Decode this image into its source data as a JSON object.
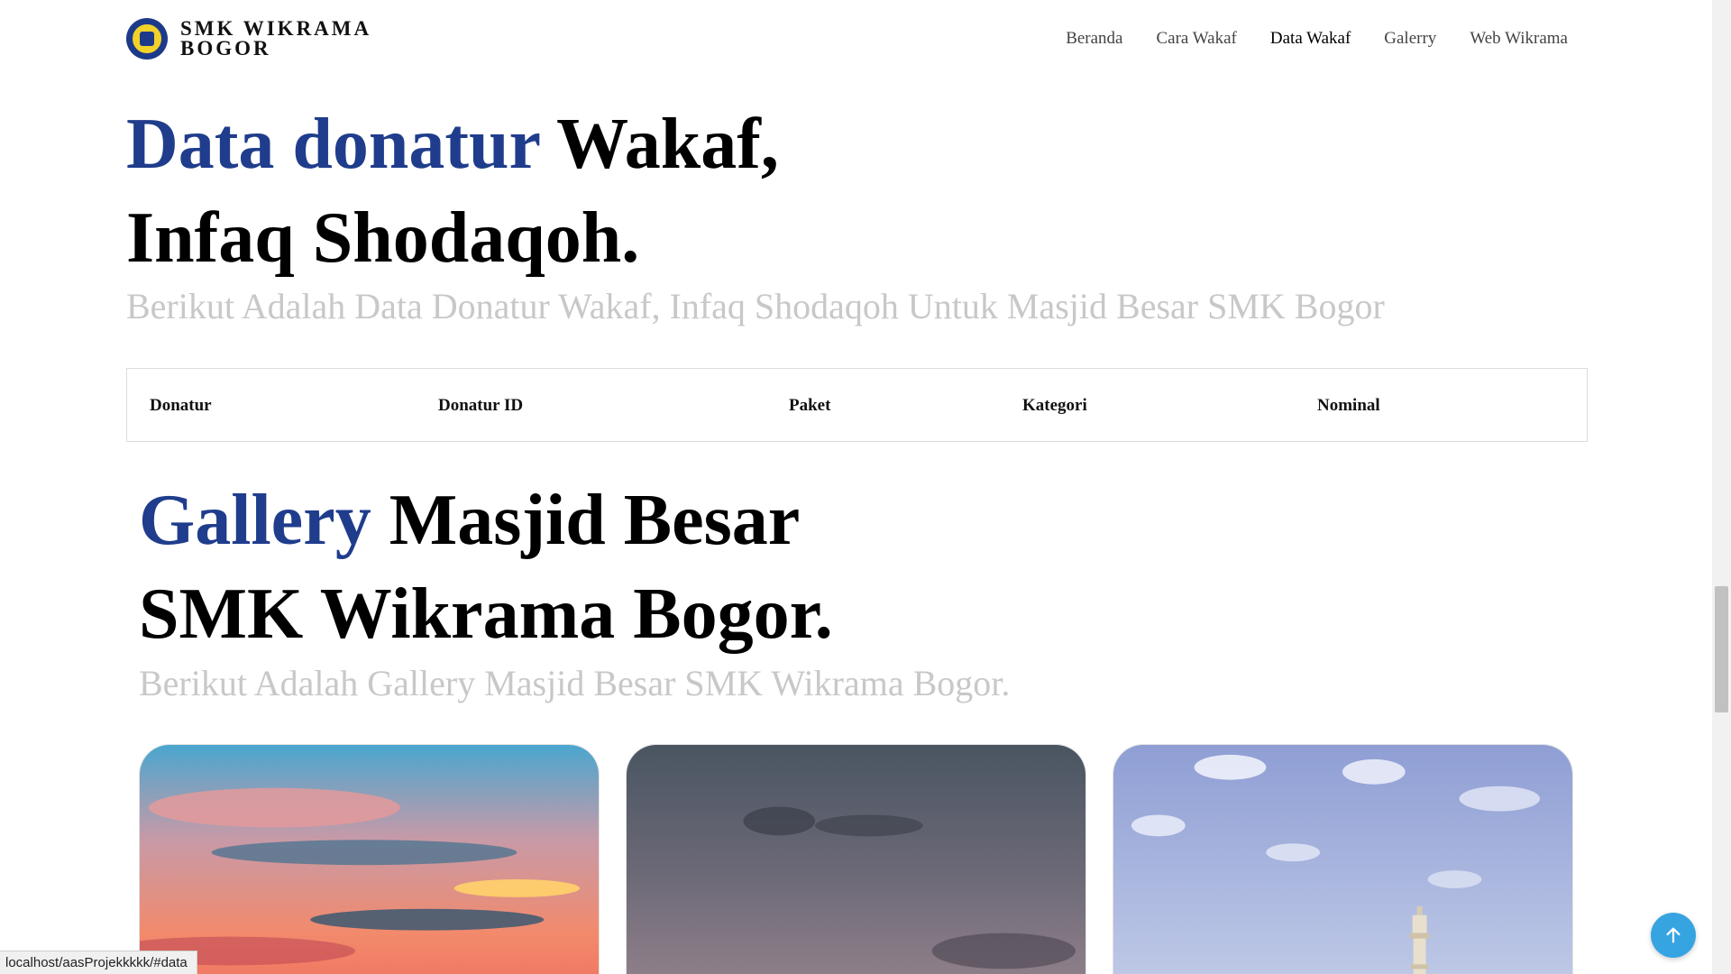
{
  "brand": {
    "line1": "SMK WIKRAMA",
    "line2": "BOGOR"
  },
  "nav": {
    "items": [
      {
        "label": "Beranda"
      },
      {
        "label": "Cara Wakaf"
      },
      {
        "label": "Data Wakaf"
      },
      {
        "label": "Galerry"
      },
      {
        "label": "Web Wikrama"
      }
    ],
    "active": "Data Wakaf"
  },
  "data_section": {
    "title_accent": "Data donatur",
    "title_rest_1": " Wakaf,",
    "title_line2": "Infaq Shodaqoh.",
    "subtitle": "Berikut Adalah Data Donatur Wakaf, Infaq Shodaqoh Untuk Masjid Besar SMK Bogor",
    "table": {
      "columns": [
        "Donatur",
        "Donatur ID",
        "Paket",
        "Kategori",
        "Nominal"
      ],
      "rows": []
    }
  },
  "gallery_section": {
    "title_accent": "Gallery",
    "title_rest_1": " Masjid Besar",
    "title_line2": "SMK Wikrama Bogor.",
    "subtitle": "Berikut Adalah Gallery Masjid Besar SMK Wikrama Bogor."
  },
  "status_bar": {
    "url": "localhost/aasProjekkkkk/#data"
  },
  "colors": {
    "accent": "#1f3d8c",
    "subtitle": "#c8c8c8",
    "to_top": "#37a4e2"
  },
  "icons": {
    "to_top": "arrow-up-icon",
    "logo": "school-logo-icon"
  }
}
